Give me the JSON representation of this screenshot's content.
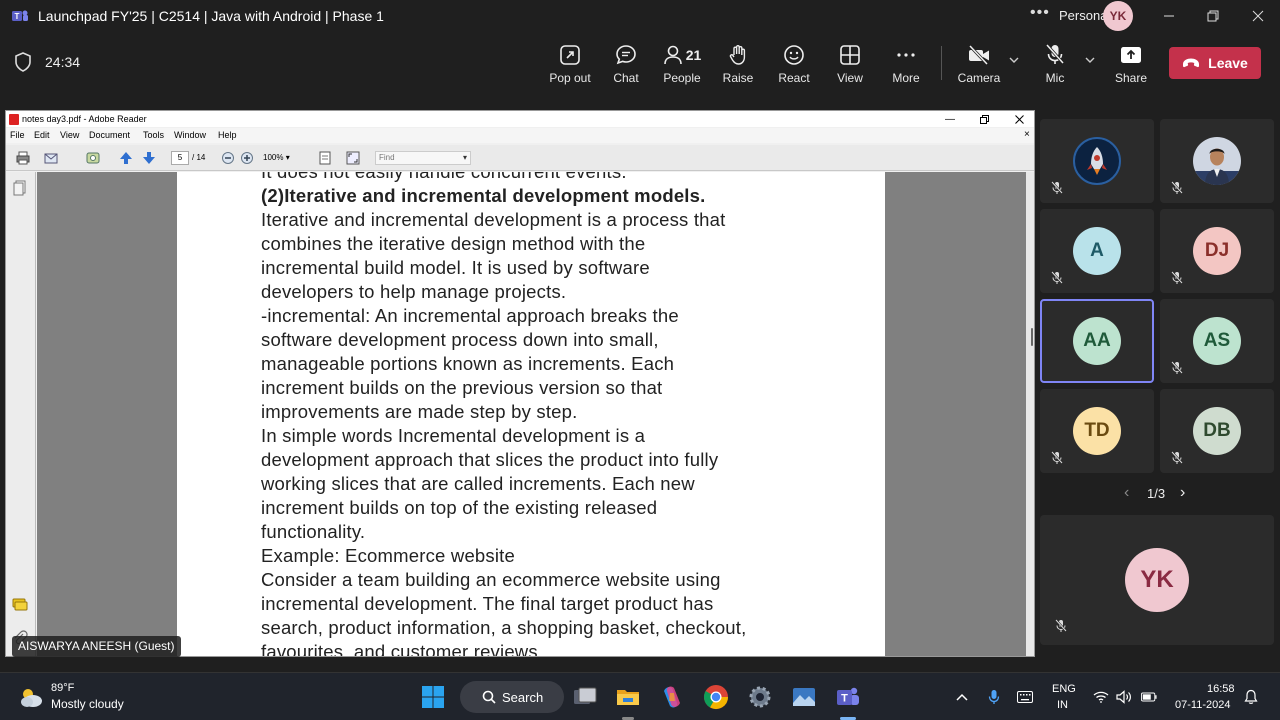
{
  "window": {
    "title": "Launchpad FY'25 | C2514 | Java with Android | Phase 1",
    "personal_label": "Personal",
    "personal_initials": "YK"
  },
  "toolbar": {
    "timer": "24:34",
    "buttons": [
      {
        "label": "Pop out",
        "icon": "pop-out-icon"
      },
      {
        "label": "Chat",
        "icon": "chat-icon"
      },
      {
        "label": "People",
        "icon": "people-icon",
        "count": "21"
      },
      {
        "label": "Raise",
        "icon": "hand-icon"
      },
      {
        "label": "React",
        "icon": "smiley-icon"
      },
      {
        "label": "View",
        "icon": "grid-icon"
      },
      {
        "label": "More",
        "icon": "more-icon"
      },
      {
        "label": "Camera",
        "icon": "camera-off-icon"
      },
      {
        "label": "Mic",
        "icon": "mic-off-icon"
      },
      {
        "label": "Share",
        "icon": "share-icon"
      }
    ],
    "leave_label": "Leave",
    "leave_color": "#c4314b"
  },
  "reader": {
    "title": "notes day3.pdf - Adobe Reader",
    "menu": [
      "File",
      "Edit",
      "View",
      "Document",
      "Tools",
      "Window",
      "Help"
    ],
    "page_current": "5",
    "page_total": "/ 14",
    "zoom": "100%",
    "find_placeholder": "Find",
    "lines": [
      {
        "text": "It does not easily handle concurrent events.",
        "bold": false
      },
      {
        "text": "(2)Iterative and incremental development models.",
        "bold": true
      },
      {
        "text": "Iterative and incremental development is a process that",
        "bold": false
      },
      {
        "text": "combines the iterative design method with the",
        "bold": false
      },
      {
        "text": "incremental build model. It is used by software",
        "bold": false
      },
      {
        "text": "developers to help manage projects.",
        "bold": false
      },
      {
        "text": "-incremental: An incremental approach breaks the",
        "bold": false
      },
      {
        "text": "software development process down into small,",
        "bold": false
      },
      {
        "text": "manageable portions known as increments. Each",
        "bold": false
      },
      {
        "text": "increment builds on the previous version so that",
        "bold": false
      },
      {
        "text": "improvements are made step by step.",
        "bold": false
      },
      {
        "text": "In simple words Incremental development is a",
        "bold": false
      },
      {
        "text": "development approach that slices the product into fully",
        "bold": false
      },
      {
        "text": "working slices that are called increments. Each new",
        "bold": false
      },
      {
        "text": "increment builds on top of the existing released",
        "bold": false
      },
      {
        "text": "functionality.",
        "bold": false
      },
      {
        "text": "Example: Ecommerce website",
        "bold": false
      },
      {
        "text": "Consider a team building an ecommerce website using",
        "bold": false
      },
      {
        "text": "incremental development. The final target product has",
        "bold": false
      },
      {
        "text": "search, product information, a shopping basket, checkout,",
        "bold": false
      },
      {
        "text": "favourites, and customer reviews.",
        "bold": false
      }
    ]
  },
  "presenter_name": "AISWARYA ANEESH (Guest)",
  "gallery": {
    "tiles": [
      {
        "initials": "",
        "type": "logo",
        "muted": true
      },
      {
        "initials": "",
        "type": "photo",
        "muted": true
      },
      {
        "initials": "A",
        "bg": "#b9e2ea",
        "fg": "#1e5a66",
        "muted": true
      },
      {
        "initials": "DJ",
        "bg": "#f3c6c3",
        "fg": "#8a2f2a",
        "muted": true
      },
      {
        "initials": "AA",
        "bg": "#bde3cf",
        "fg": "#1f5a3a",
        "muted": false,
        "active": true
      },
      {
        "initials": "AS",
        "bg": "#bde3cf",
        "fg": "#1f5a3a",
        "muted": true
      },
      {
        "initials": "TD",
        "bg": "#fbe1a6",
        "fg": "#6a4a10",
        "muted": true
      },
      {
        "initials": "DB",
        "bg": "#cfdccf",
        "fg": "#2f4a2f",
        "muted": true
      }
    ],
    "pager": "1/3",
    "self_initials": "YK"
  },
  "taskbar": {
    "weather_temp": "89°F",
    "weather_desc": "Mostly cloudy",
    "search_label": "Search",
    "lang_line1": "ENG",
    "lang_line2": "IN",
    "time": "16:58",
    "date": "07-11-2024"
  }
}
